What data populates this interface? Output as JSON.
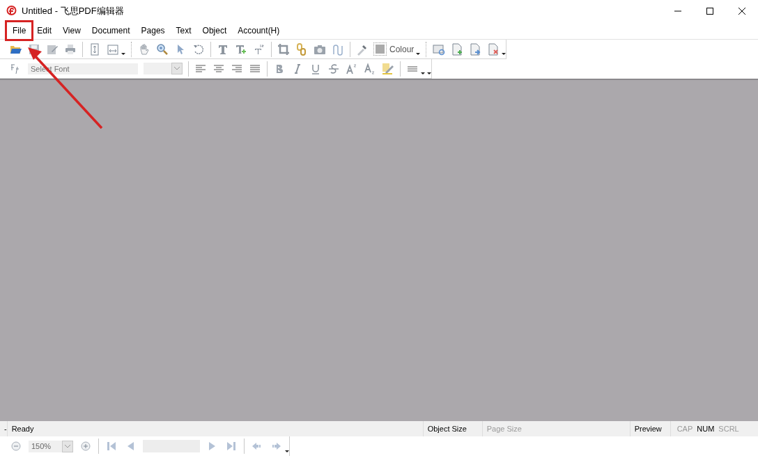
{
  "window": {
    "title": "Untitled - 飞思PDF编辑器"
  },
  "menu": [
    {
      "label": "File",
      "highlighted": true
    },
    {
      "label": "Edit",
      "highlighted": false
    },
    {
      "label": "View",
      "highlighted": false
    },
    {
      "label": "Document",
      "highlighted": false
    },
    {
      "label": "Pages",
      "highlighted": false
    },
    {
      "label": "Text",
      "highlighted": false
    },
    {
      "label": "Object",
      "highlighted": false
    },
    {
      "label": "Account(H)",
      "highlighted": false
    }
  ],
  "toolbar": {
    "colour_label": "Colour"
  },
  "format_bar": {
    "font_placeholder": "Select Font"
  },
  "status_marker": "-",
  "status_bar": [
    {
      "text": "Ready",
      "disabled": false
    },
    {
      "text": "Object Size",
      "disabled": false
    },
    {
      "text": "Page Size",
      "disabled": true
    },
    {
      "text": "Preview",
      "disabled": false
    }
  ],
  "indicators": [
    {
      "text": "CAP",
      "disabled": true
    },
    {
      "text": "NUM",
      "disabled": false
    },
    {
      "text": "SCRL",
      "disabled": true
    }
  ],
  "nav_bar": {
    "zoom": "150%"
  }
}
